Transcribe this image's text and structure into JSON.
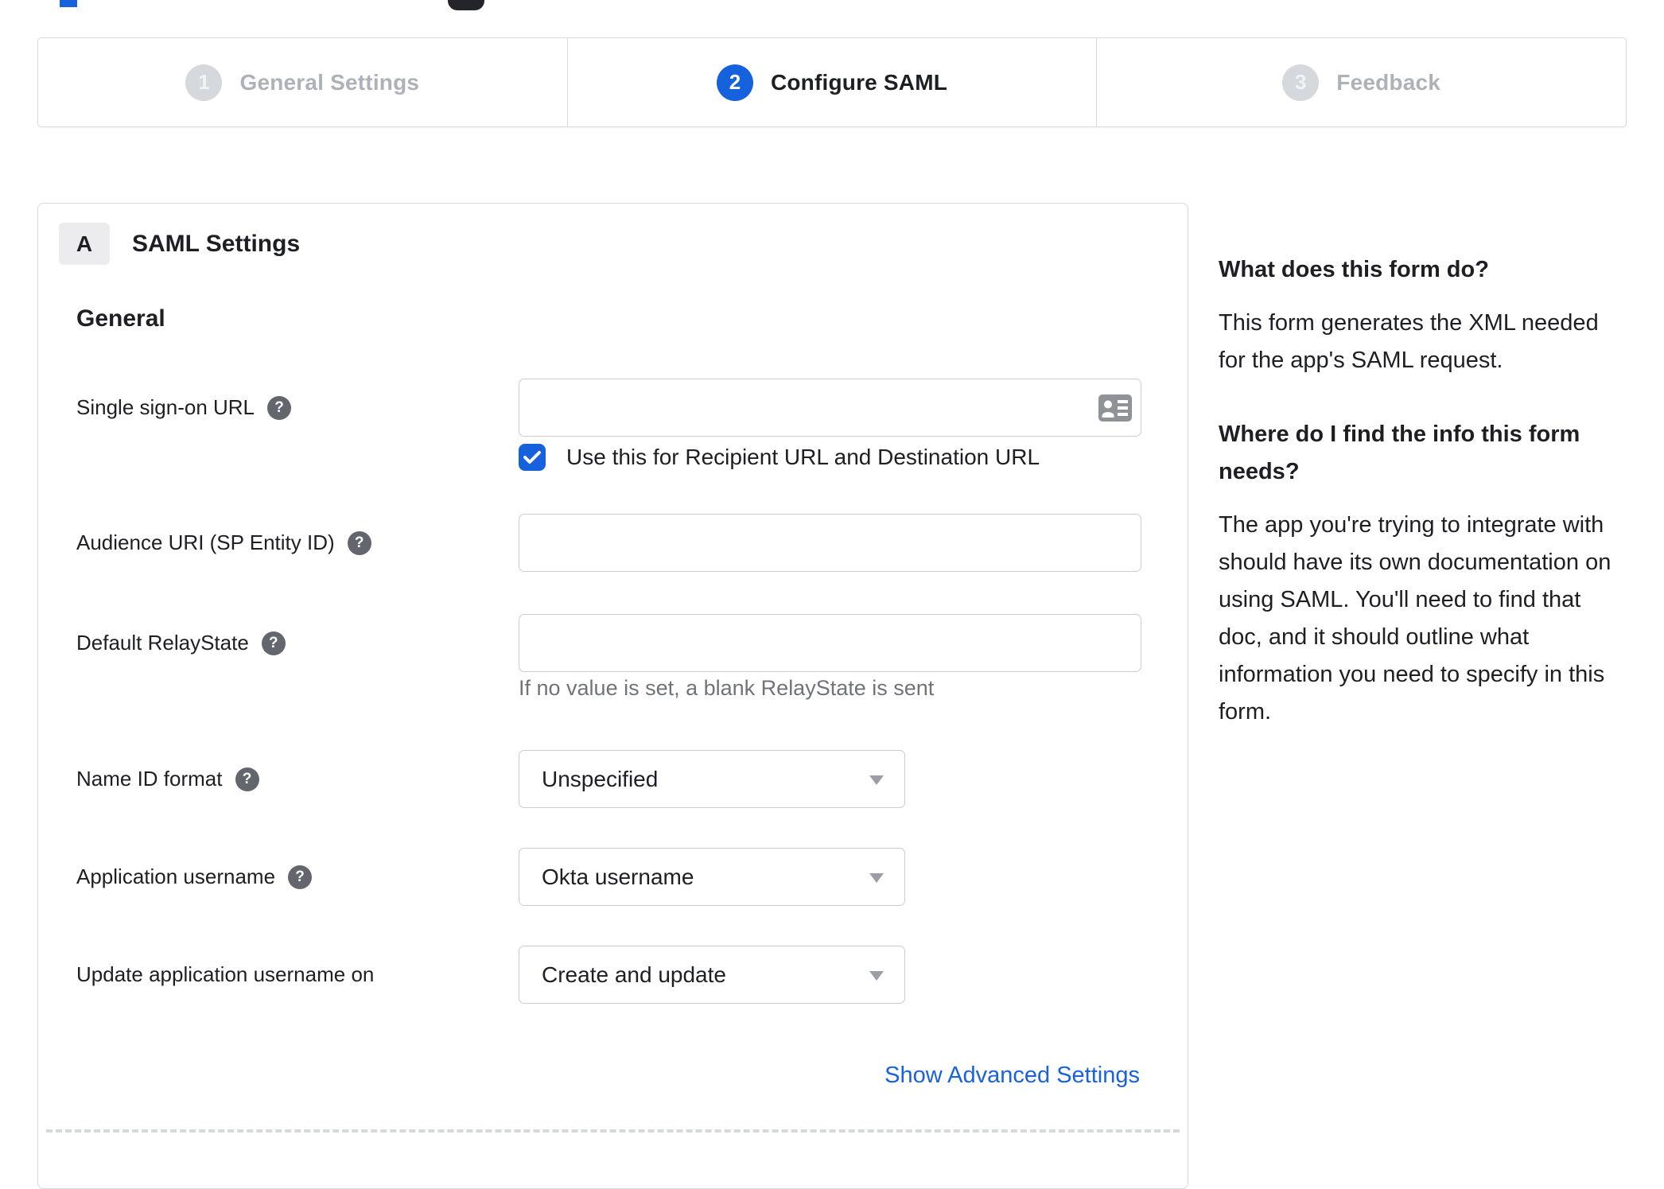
{
  "icons": {
    "help_glyph": "?",
    "sso_input_icon": "contact-card-icon",
    "select_caret": "caret-down-icon",
    "checkbox_check": "checkmark-icon"
  },
  "stepper": {
    "steps": [
      {
        "number": "1",
        "label": "General Settings",
        "state": "inactive"
      },
      {
        "number": "2",
        "label": "Configure SAML",
        "state": "active"
      },
      {
        "number": "3",
        "label": "Feedback",
        "state": "inactive"
      }
    ]
  },
  "panel": {
    "badge_label": "A",
    "title": "SAML Settings",
    "section_heading": "General",
    "fields": {
      "sso_url": {
        "label": "Single sign-on URL",
        "value": "",
        "has_help": true
      },
      "recipient_checkbox": {
        "checked": true,
        "label": "Use this for Recipient URL and Destination URL"
      },
      "audience_uri": {
        "label": "Audience URI (SP Entity ID)",
        "value": "",
        "has_help": true
      },
      "default_relay_state": {
        "label": "Default RelayState",
        "value": "",
        "has_help": true,
        "helper_text": "If no value is set, a blank RelayState is sent"
      },
      "name_id_format": {
        "label": "Name ID format",
        "value": "Unspecified",
        "has_help": true
      },
      "application_username": {
        "label": "Application username",
        "value": "Okta username",
        "has_help": true
      },
      "update_app_username_on": {
        "label": "Update application username on",
        "value": "Create and update"
      }
    },
    "advanced_link": "Show Advanced Settings"
  },
  "sidebar": {
    "sections": [
      {
        "heading": "What does this form do?",
        "body": "This form generates the XML needed for the app's SAML request."
      },
      {
        "heading": "Where do I find the info this form needs?",
        "body": "The app you're trying to integrate with should have its own documentation on using SAML. You'll need to find that doc, and it should outline what information you need to specify in this form."
      }
    ]
  },
  "colors": {
    "accent_blue": "#1662dd",
    "link_blue": "#1a62dc",
    "step_inactive_gray": "#d5d8dc",
    "inactive_label_gray": "#aeb2b8",
    "text_dark": "#1d1f24",
    "input_border_gray": "#c9ccd1",
    "panel_border_gray": "#d7dade",
    "helper_gray": "#6f747a",
    "help_icon_gray": "#63666c",
    "badge_bg_gray": "#ececee"
  }
}
